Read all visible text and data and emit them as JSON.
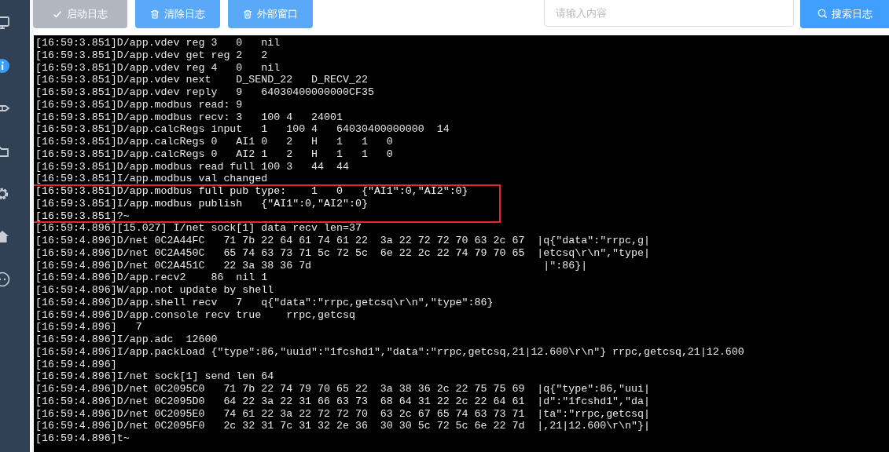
{
  "sidebar": {
    "items": [
      {
        "selected": false
      },
      {
        "selected": true
      },
      {
        "selected": false
      },
      {
        "selected": false
      },
      {
        "selected": false
      },
      {
        "selected": false
      },
      {
        "selected": false
      }
    ]
  },
  "toolbar": {
    "buttons": [
      {
        "label": "启动日志",
        "disabled": true
      },
      {
        "label": "清除日志",
        "disabled": false
      },
      {
        "label": "外部窗口",
        "disabled": false
      }
    ],
    "search": {
      "placeholder": "请输入内容",
      "button": "搜索日志"
    }
  },
  "log": {
    "lines": [
      {
        "text": "[16:59:3.851]D/app.vdev reg 3   0   nil",
        "highlighted": false
      },
      {
        "text": "[16:59:3.851]D/app.vdev get reg 2   2",
        "highlighted": false
      },
      {
        "text": "[16:59:3.851]D/app.vdev reg 4   0   nil",
        "highlighted": false
      },
      {
        "text": "[16:59:3.851]D/app.vdev next    D_SEND_22   D_RECV_22",
        "highlighted": false
      },
      {
        "text": "[16:59:3.851]D/app.vdev reply   9   64030400000000CF35",
        "highlighted": false
      },
      {
        "text": "[16:59:3.851]D/app.modbus read: 9",
        "highlighted": false
      },
      {
        "text": "[16:59:3.851]D/app.modbus recv: 3   100 4   24001",
        "highlighted": false
      },
      {
        "text": "[16:59:3.851]D/app.calcRegs input   1   100 4   64030400000000  14",
        "highlighted": false
      },
      {
        "text": "[16:59:3.851]D/app.calcRegs 0   AI1 0   2   H   1   1   0",
        "highlighted": false
      },
      {
        "text": "[16:59:3.851]D/app.calcRegs 0   AI2 1   2   H   1   1   0",
        "highlighted": false
      },
      {
        "text": "[16:59:3.851]D/app.modbus read full 100 3   44  44",
        "highlighted": false
      },
      {
        "text": "[16:59:3.851]I/app.modbus val changed",
        "highlighted": false
      },
      {
        "text": "[16:59:3.851]D/app.modbus full pub type:    1   0   {\"AI1\":0,\"AI2\":0}",
        "highlighted": true
      },
      {
        "text": "[16:59:3.851]I/app.modbus publish   {\"AI1\":0,\"AI2\":0}",
        "highlighted": true
      },
      {
        "text": "[16:59:3.851]?~",
        "highlighted": true
      },
      {
        "text": "[16:59:4.896][15.027] I/net sock[1] data recv len=37",
        "highlighted": false
      },
      {
        "text": "[16:59:4.896]D/net 0C2A44FC   71 7b 22 64 61 74 61 22  3a 22 72 72 70 63 2c 67  |q{\"data\":\"rrpc,g|",
        "highlighted": false
      },
      {
        "text": "[16:59:4.896]D/net 0C2A450C   65 74 63 73 71 5c 72 5c  6e 22 2c 22 74 79 70 65  |etcsq\\r\\n\",\"type|",
        "highlighted": false
      },
      {
        "text": "[16:59:4.896]D/net 0C2A451C   22 3a 38 36 7d                                     |\":86}|",
        "highlighted": false
      },
      {
        "text": "[16:59:4.896]D/app.recv2    86  nil 1",
        "highlighted": false
      },
      {
        "text": "[16:59:4.896]W/app.not update by shell",
        "highlighted": false
      },
      {
        "text": "[16:59:4.896]D/app.shell recv   7   q{\"data\":\"rrpc,getcsq\\r\\n\",\"type\":86}",
        "highlighted": false
      },
      {
        "text": "[16:59:4.896]D/app.console recv true    rrpc,getcsq",
        "highlighted": false
      },
      {
        "text": "[16:59:4.896]   7",
        "highlighted": false
      },
      {
        "text": "[16:59:4.896]I/app.adc  12600",
        "highlighted": false
      },
      {
        "text": "[16:59:4.896]I/app.packLoad {\"type\":86,\"uuid\":\"1fcshd1\",\"data\":\"rrpc,getcsq,21|12.600\\r\\n\"} rrpc,getcsq,21|12.600",
        "highlighted": false
      },
      {
        "text": "[16:59:4.896]",
        "highlighted": false
      },
      {
        "text": "[16:59:4.896]I/net sock[1] send len 64",
        "highlighted": false
      },
      {
        "text": "[16:59:4.896]D/net 0C2095C0   71 7b 22 74 79 70 65 22  3a 38 36 2c 22 75 75 69  |q{\"type\":86,\"uui|",
        "highlighted": false
      },
      {
        "text": "[16:59:4.896]D/net 0C2095D0   64 22 3a 22 31 66 63 73  68 64 31 22 2c 22 64 61  |d\":\"1fcshd1\",\"da|",
        "highlighted": false
      },
      {
        "text": "[16:59:4.896]D/net 0C2095E0   74 61 22 3a 22 72 72 70  63 2c 67 65 74 63 73 71  |ta\":\"rrpc,getcsq|",
        "highlighted": false
      },
      {
        "text": "[16:59:4.896]D/net 0C2095F0   2c 32 31 7c 31 32 2e 36  30 30 5c 72 5c 6e 22 7d  |,21|12.600\\r\\n\"}|",
        "highlighted": false
      },
      {
        "text": "[16:59:4.896]t~",
        "highlighted": false
      }
    ]
  }
}
